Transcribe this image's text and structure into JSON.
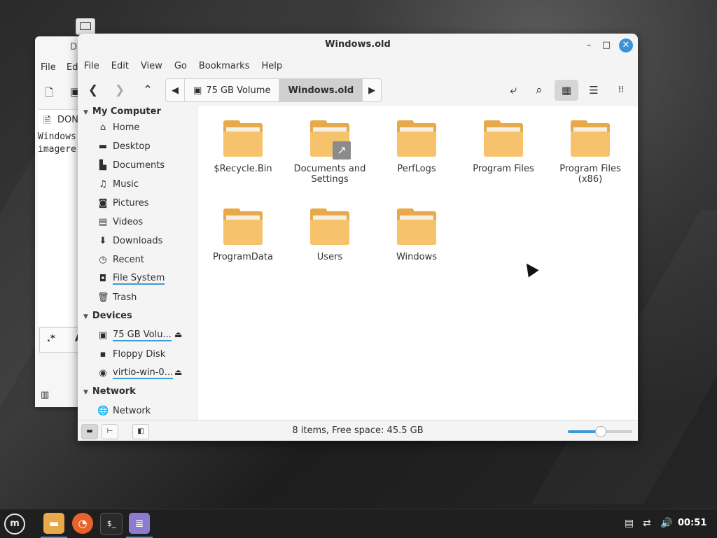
{
  "window": {
    "title": "Windows.old",
    "buttons": {
      "minimize": "–",
      "maximize": "□",
      "close": "✕"
    }
  },
  "menubar": [
    "File",
    "Edit",
    "View",
    "Go",
    "Bookmarks",
    "Help"
  ],
  "toolbar": {
    "back": "❮",
    "forward": "❯",
    "up": "⌃",
    "path": [
      "75 GB Volume",
      "Windows.old"
    ]
  },
  "sidebar": {
    "my_computer": {
      "heading": "My Computer",
      "items": [
        {
          "label": "Home",
          "icon": "home-icon"
        },
        {
          "label": "Desktop",
          "icon": "desktop-icon"
        },
        {
          "label": "Documents",
          "icon": "documents-icon"
        },
        {
          "label": "Music",
          "icon": "music-icon"
        },
        {
          "label": "Pictures",
          "icon": "pictures-icon"
        },
        {
          "label": "Videos",
          "icon": "videos-icon"
        },
        {
          "label": "Downloads",
          "icon": "downloads-icon"
        },
        {
          "label": "Recent",
          "icon": "recent-icon"
        },
        {
          "label": "File System",
          "icon": "file-system-icon"
        },
        {
          "label": "Trash",
          "icon": "trash-icon"
        }
      ]
    },
    "devices": {
      "heading": "Devices",
      "items": [
        {
          "label": "75 GB Volu...",
          "icon": "drive-icon",
          "eject": true
        },
        {
          "label": "Floppy Disk",
          "icon": "floppy-icon",
          "eject": false
        },
        {
          "label": "virtio-win-0...",
          "icon": "cdrom-icon",
          "eject": true
        }
      ]
    },
    "network": {
      "heading": "Network",
      "items": [
        {
          "label": "Network",
          "icon": "network-icon"
        }
      ]
    }
  },
  "files": [
    {
      "name": "$Recycle.Bin",
      "link": false
    },
    {
      "name": "Documents and Settings",
      "link": true
    },
    {
      "name": "PerfLogs",
      "link": false
    },
    {
      "name": "Program Files",
      "link": false
    },
    {
      "name": "Program Files (x86)",
      "link": false
    },
    {
      "name": "ProgramData",
      "link": false
    },
    {
      "name": "Users",
      "link": false
    },
    {
      "name": "Windows",
      "link": false
    }
  ],
  "status": {
    "text": "8 items, Free space: 45.5 GB",
    "zoom_fraction": 0.5
  },
  "bg_window": {
    "title_fragment": "D",
    "menu": [
      "File",
      "Ed"
    ],
    "tab": "DON",
    "lines": [
      "Windows",
      "imagere"
    ],
    "find_label": ".*",
    "find_frag": "A"
  },
  "taskbar": {
    "apps": [
      "file-manager-icon",
      "firefox-icon",
      "terminal-icon",
      "text-editor-icon"
    ],
    "clock": "00:51"
  },
  "colors": {
    "accent": "#3b9bd9",
    "folder_front": "#f6c36c",
    "folder_back": "#e8a94a",
    "taskbar": "#1f1f1f"
  }
}
